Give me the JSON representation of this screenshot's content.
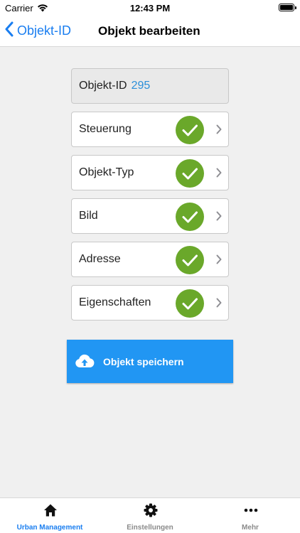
{
  "status_bar": {
    "carrier": "Carrier",
    "time": "12:43 PM"
  },
  "nav": {
    "back_label": "Objekt-ID",
    "title": "Objekt bearbeiten"
  },
  "object": {
    "id_label": "Objekt-ID",
    "id_value": "295"
  },
  "sections": [
    {
      "label": "Steuerung",
      "complete": true
    },
    {
      "label": "Objekt-Typ",
      "complete": true
    },
    {
      "label": "Bild",
      "complete": true
    },
    {
      "label": "Adresse",
      "complete": true
    },
    {
      "label": "Eigenschaften",
      "complete": true
    }
  ],
  "save_button": {
    "label": "Objekt speichern",
    "icon": "cloud-upload-icon"
  },
  "tab_bar": {
    "tabs": [
      {
        "label": "Urban Management",
        "icon": "home-icon",
        "active": true
      },
      {
        "label": "Einstellungen",
        "icon": "gear-icon",
        "active": false
      },
      {
        "label": "Mehr",
        "icon": "more-dots-icon",
        "active": false
      }
    ]
  },
  "colors": {
    "accent": "#1a7ef0",
    "id_value": "#2b8fd9",
    "check": "#6aa82a",
    "save_button": "#2196f3",
    "background": "#f0f0f0"
  }
}
